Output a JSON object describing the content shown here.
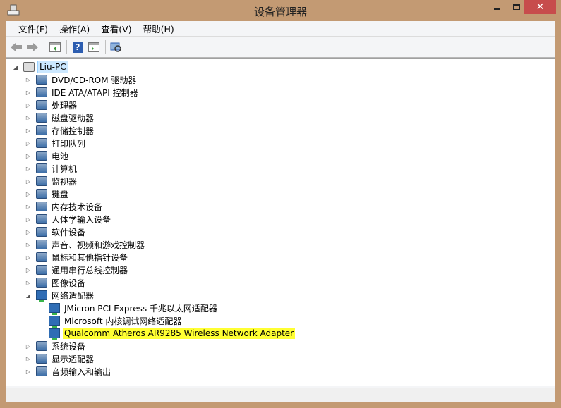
{
  "window": {
    "title": "设备管理器",
    "close": "✕"
  },
  "menu": [
    "文件(F)",
    "操作(A)",
    "查看(V)",
    "帮助(H)"
  ],
  "toolbar": {
    "help": "?"
  },
  "tree": {
    "root": "Liu-PC",
    "categories": [
      {
        "label": "DVD/CD-ROM 驱动器",
        "icon": "disc-drive-icon"
      },
      {
        "label": "IDE ATA/ATAPI 控制器",
        "icon": "ide-controller-icon"
      },
      {
        "label": "处理器",
        "icon": "processor-icon"
      },
      {
        "label": "磁盘驱动器",
        "icon": "disk-drive-icon"
      },
      {
        "label": "存储控制器",
        "icon": "storage-controller-icon"
      },
      {
        "label": "打印队列",
        "icon": "printer-icon"
      },
      {
        "label": "电池",
        "icon": "battery-icon"
      },
      {
        "label": "计算机",
        "icon": "computer-icon"
      },
      {
        "label": "监视器",
        "icon": "monitor-icon"
      },
      {
        "label": "键盘",
        "icon": "keyboard-icon"
      },
      {
        "label": "内存技术设备",
        "icon": "memory-icon"
      },
      {
        "label": "人体学输入设备",
        "icon": "hid-icon"
      },
      {
        "label": "软件设备",
        "icon": "software-device-icon"
      },
      {
        "label": "声音、视频和游戏控制器",
        "icon": "sound-icon"
      },
      {
        "label": "鼠标和其他指针设备",
        "icon": "mouse-icon"
      },
      {
        "label": "通用串行总线控制器",
        "icon": "usb-icon"
      },
      {
        "label": "图像设备",
        "icon": "camera-icon"
      },
      {
        "label": "网络适配器",
        "icon": "network-adapter-icon",
        "expanded": true,
        "children": [
          "JMicron PCI Express 千兆以太网适配器",
          "Microsoft 内核调试网络适配器",
          "Qualcomm Atheros AR9285 Wireless Network Adapter"
        ]
      },
      {
        "label": "系统设备",
        "icon": "system-device-icon"
      },
      {
        "label": "显示适配器",
        "icon": "display-adapter-icon"
      },
      {
        "label": "音频输入和输出",
        "icon": "audio-io-icon"
      }
    ]
  },
  "colors": {
    "titlebar": "#c39a73",
    "close": "#c74c4c",
    "highlight": "#ffff33"
  }
}
